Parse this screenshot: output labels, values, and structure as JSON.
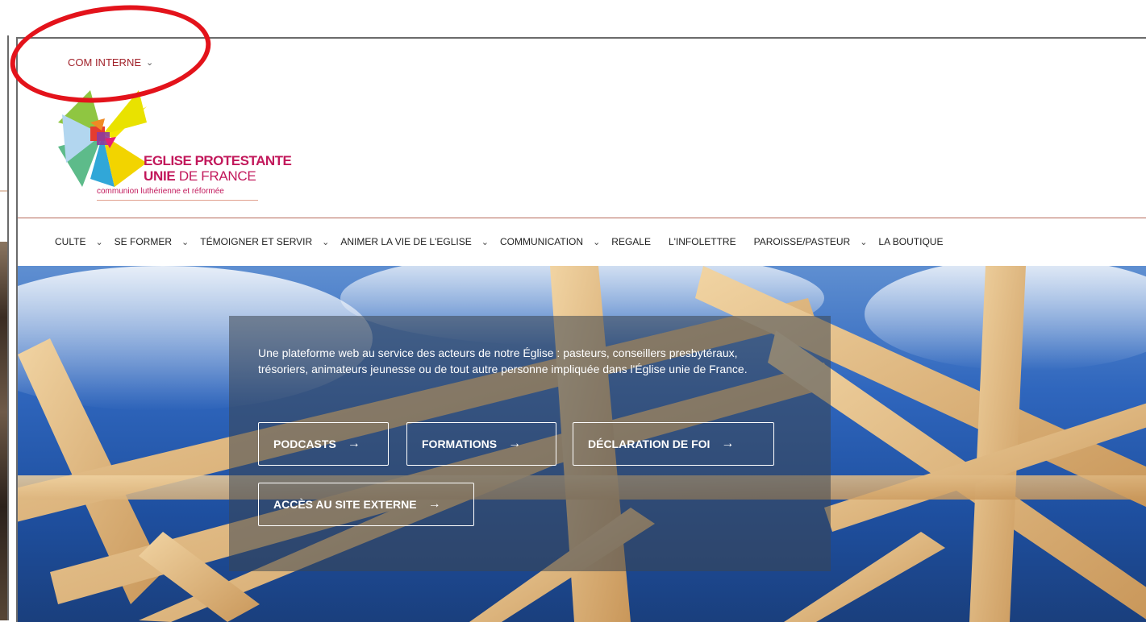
{
  "top_menu": {
    "label": "COM INTERNE",
    "icon": "chevron-down-icon"
  },
  "logo": {
    "line1": "EGLISE PROTESTANTE",
    "line2_bold": "UNIE",
    "line2_rest": " DE FRANCE",
    "tagline": "communion luthérienne et réformée"
  },
  "nav": [
    {
      "label": "CULTE",
      "dropdown": true
    },
    {
      "label": "SE FORMER",
      "dropdown": true
    },
    {
      "label": "TÉMOIGNER ET SERVIR",
      "dropdown": true
    },
    {
      "label": "ANIMER LA VIE DE L'EGLISE",
      "dropdown": true
    },
    {
      "label": "COMMUNICATION",
      "dropdown": true
    },
    {
      "label": "REGALE",
      "dropdown": false
    },
    {
      "label": "L'INFOLETTRE",
      "dropdown": false
    },
    {
      "label": "PAROISSE/PASTEUR",
      "dropdown": true
    },
    {
      "label": "LA BOUTIQUE",
      "dropdown": false
    }
  ],
  "hero": {
    "intro": "Une plateforme web au service des acteurs de notre Église : pasteurs, conseillers presbytéraux, trésoriers, animateurs jeunesse ou de tout autre personne impliquée dans l'Église unie de France.",
    "buttons": [
      "PODCASTS",
      "FORMATIONS",
      "DÉCLARATION DE FOI",
      "ACCÈS AU SITE EXTERNE"
    ]
  },
  "colors": {
    "accent": "#a2232b",
    "logo_magenta": "#c2185b",
    "annotation": "#e3131b"
  }
}
